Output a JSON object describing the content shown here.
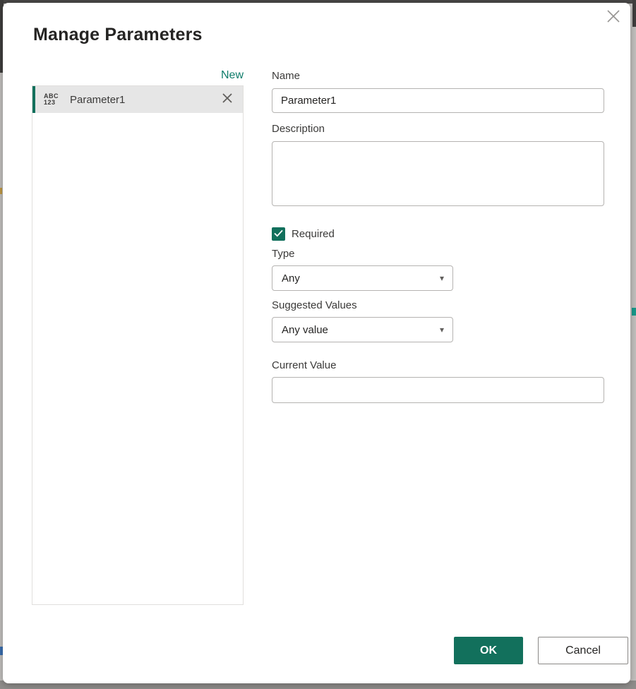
{
  "dialog": {
    "title": "Manage Parameters"
  },
  "colors": {
    "accent_teal": "#12705c",
    "link_teal": "#0e7c6a",
    "list_item_bg": "#e6e6e6"
  },
  "icons": {
    "close": "x-icon",
    "delete_item": "x-icon",
    "dropdown_arrow": "▾",
    "checkmark": "check-icon",
    "parameter_type_line1": "ABC",
    "parameter_type_line2": "123"
  },
  "parameter_list": {
    "new_label": "New",
    "items": [
      {
        "name": "Parameter1"
      }
    ]
  },
  "form": {
    "name": {
      "label": "Name",
      "value": "Parameter1"
    },
    "description": {
      "label": "Description",
      "value": ""
    },
    "required": {
      "label": "Required",
      "checked": true
    },
    "type": {
      "label": "Type",
      "selected": "Any"
    },
    "suggested_values": {
      "label": "Suggested Values",
      "selected": "Any value"
    },
    "current_value": {
      "label": "Current Value",
      "value": "",
      "placeholder": ""
    }
  },
  "footer": {
    "ok_label": "OK",
    "cancel_label": "Cancel"
  }
}
